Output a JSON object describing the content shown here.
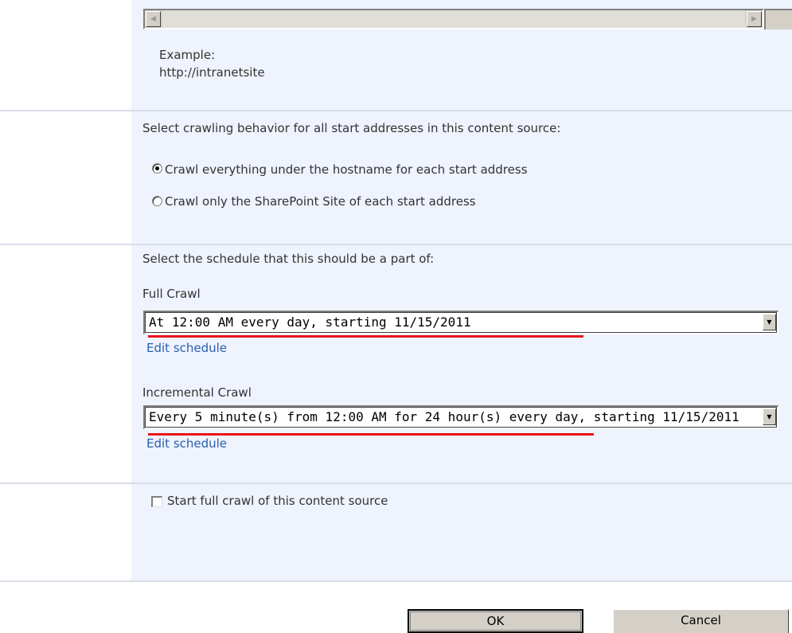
{
  "start_addresses": {
    "example_label": "Example:",
    "example_url": "http://intranetsite"
  },
  "crawl_behavior": {
    "prompt": "Select crawling behavior for all start addresses in this content source:",
    "options": [
      {
        "label": "Crawl everything under the hostname for each start address",
        "selected": true
      },
      {
        "label": "Crawl only the SharePoint Site of each start address",
        "selected": false
      }
    ]
  },
  "schedule": {
    "prompt": "Select the schedule that this should be a part of:",
    "full_crawl": {
      "label": "Full Crawl",
      "value": "At 12:00 AM every day, starting 11/15/2011",
      "edit_link": "Edit schedule"
    },
    "incremental_crawl": {
      "label": "Incremental Crawl",
      "value": "Every 5 minute(s) from 12:00 AM for 24 hour(s) every day, starting 11/15/2011",
      "edit_link": "Edit schedule"
    }
  },
  "start_full_crawl": {
    "label": "Start full crawl of this content source",
    "checked": false
  },
  "buttons": {
    "ok": "OK",
    "cancel": "Cancel"
  },
  "colors": {
    "panel_background": "#eef3fd",
    "link": "#2a5db0",
    "highlight_underline": "#e8141b"
  }
}
